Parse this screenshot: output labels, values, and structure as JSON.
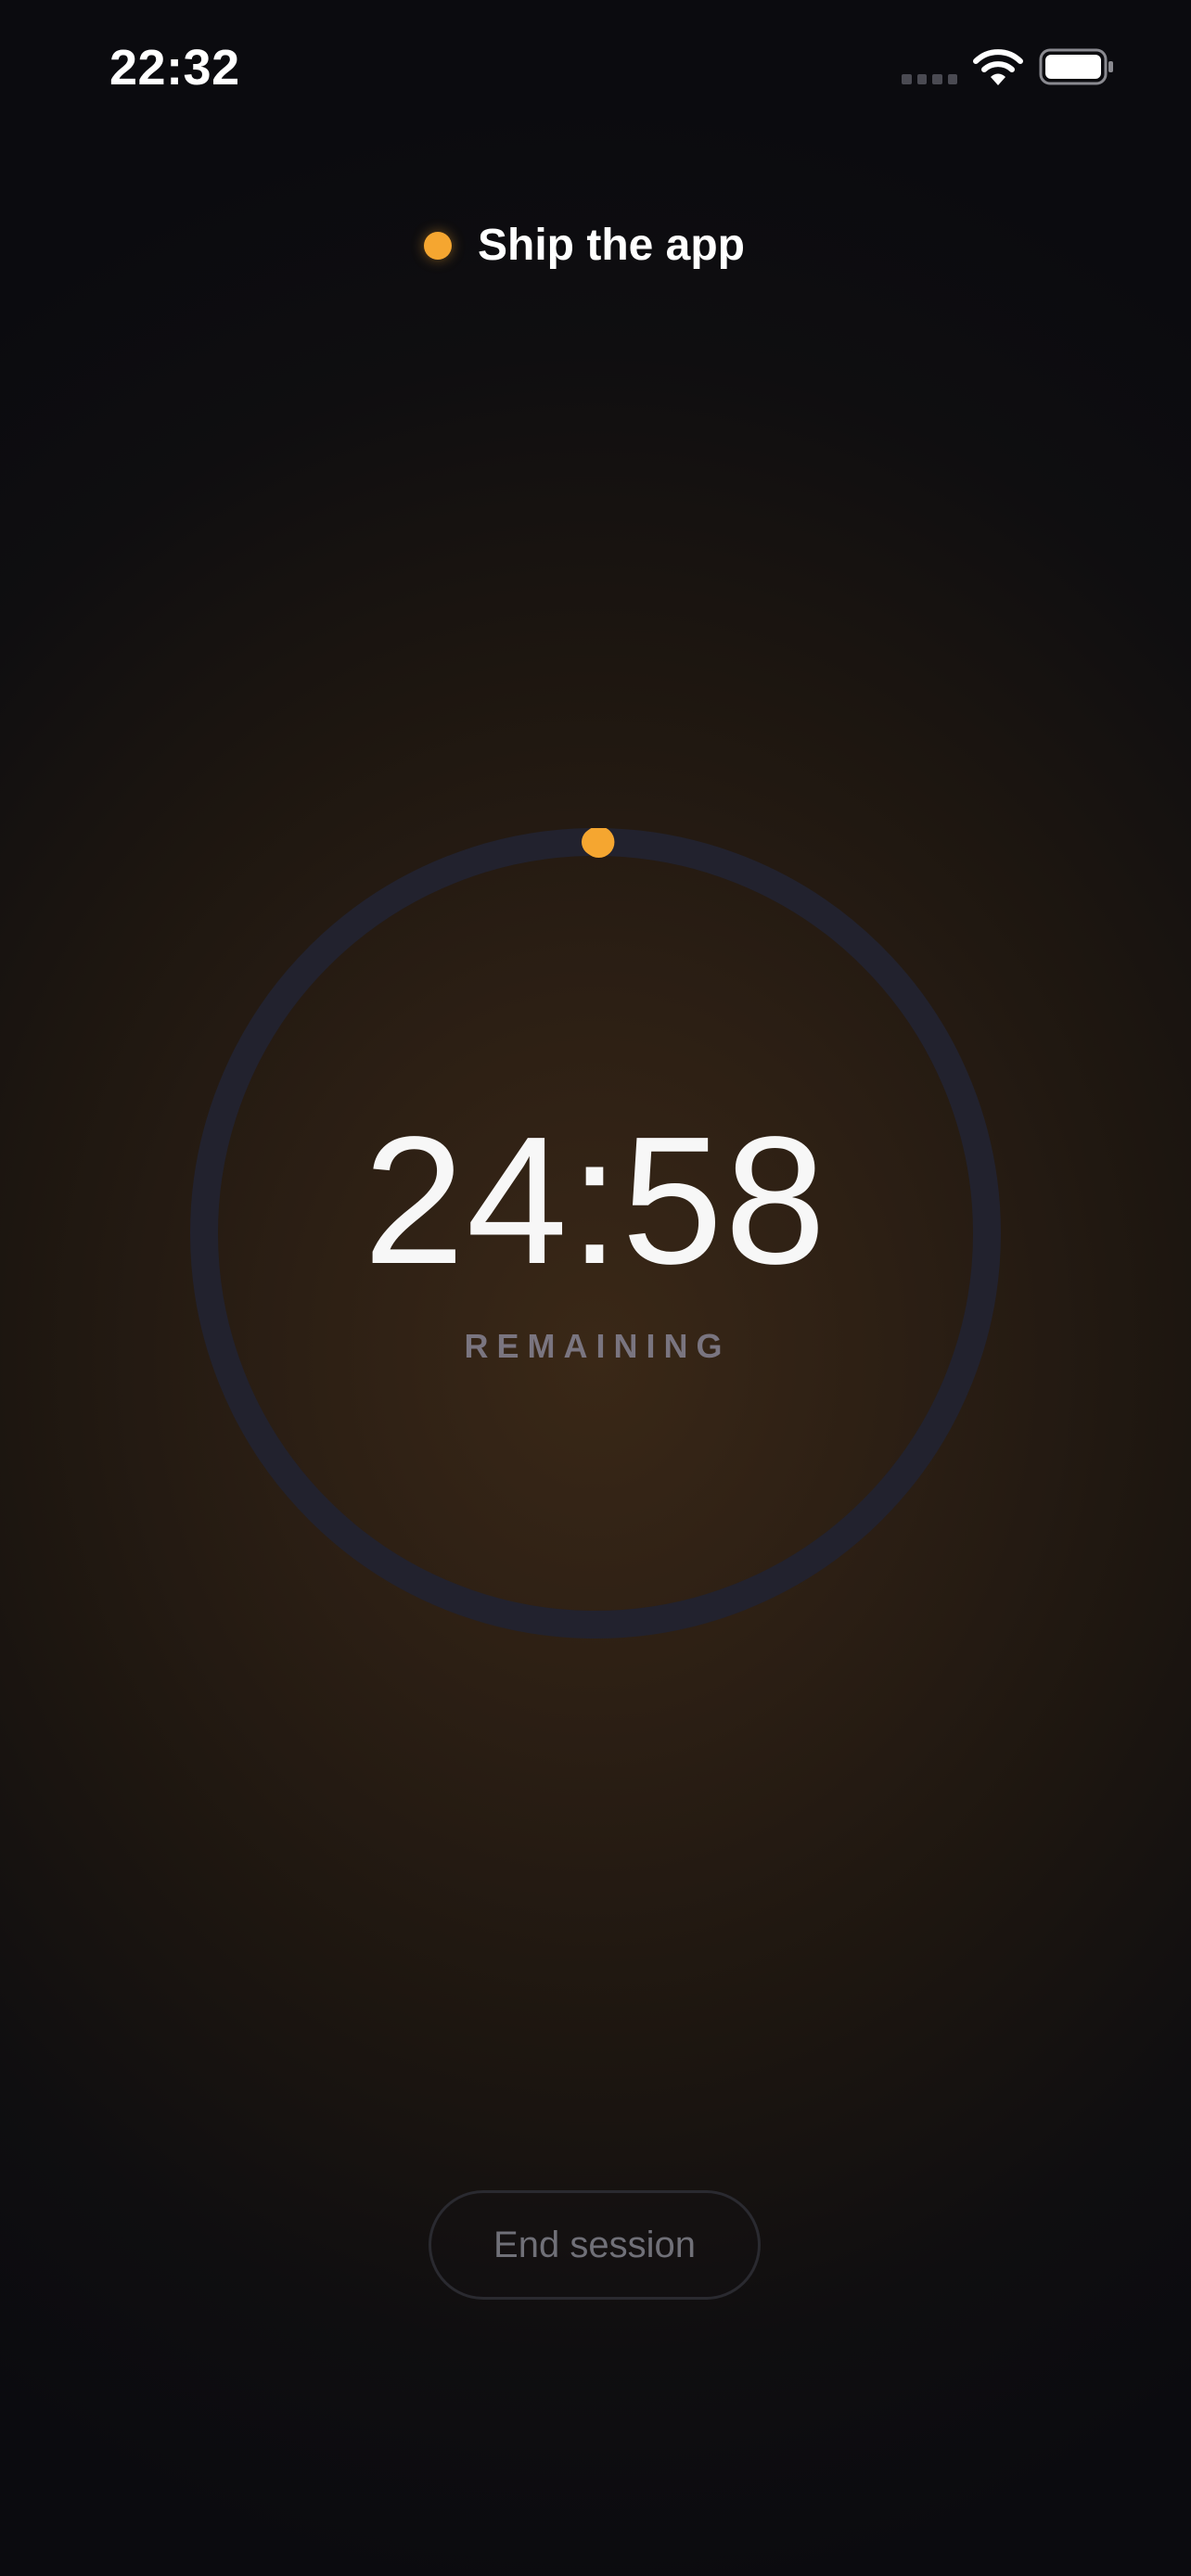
{
  "status_bar": {
    "time": "22:32",
    "icons": [
      "signal-icon",
      "wifi-icon",
      "battery-icon"
    ]
  },
  "session": {
    "task_label": "Ship the app",
    "task_color": "#f5a630",
    "timer": "24:58",
    "timer_caption": "REMAINING",
    "progress_fraction": 0.0013
  },
  "actions": {
    "end_session_label": "End session"
  },
  "colors": {
    "accent": "#f5a630",
    "ring_track": "#22222e",
    "background": "#0b0b0f"
  }
}
